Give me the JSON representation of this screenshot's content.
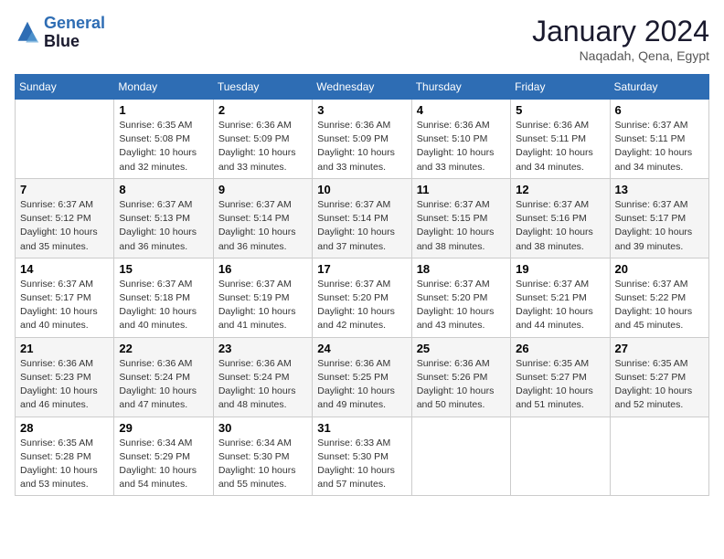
{
  "header": {
    "logo_line1": "General",
    "logo_line2": "Blue",
    "month": "January 2024",
    "location": "Naqadah, Qena, Egypt"
  },
  "days_of_week": [
    "Sunday",
    "Monday",
    "Tuesday",
    "Wednesday",
    "Thursday",
    "Friday",
    "Saturday"
  ],
  "weeks": [
    [
      {
        "day": "",
        "info": ""
      },
      {
        "day": "1",
        "info": "Sunrise: 6:35 AM\nSunset: 5:08 PM\nDaylight: 10 hours\nand 32 minutes."
      },
      {
        "day": "2",
        "info": "Sunrise: 6:36 AM\nSunset: 5:09 PM\nDaylight: 10 hours\nand 33 minutes."
      },
      {
        "day": "3",
        "info": "Sunrise: 6:36 AM\nSunset: 5:09 PM\nDaylight: 10 hours\nand 33 minutes."
      },
      {
        "day": "4",
        "info": "Sunrise: 6:36 AM\nSunset: 5:10 PM\nDaylight: 10 hours\nand 33 minutes."
      },
      {
        "day": "5",
        "info": "Sunrise: 6:36 AM\nSunset: 5:11 PM\nDaylight: 10 hours\nand 34 minutes."
      },
      {
        "day": "6",
        "info": "Sunrise: 6:37 AM\nSunset: 5:11 PM\nDaylight: 10 hours\nand 34 minutes."
      }
    ],
    [
      {
        "day": "7",
        "info": "Sunrise: 6:37 AM\nSunset: 5:12 PM\nDaylight: 10 hours\nand 35 minutes."
      },
      {
        "day": "8",
        "info": "Sunrise: 6:37 AM\nSunset: 5:13 PM\nDaylight: 10 hours\nand 36 minutes."
      },
      {
        "day": "9",
        "info": "Sunrise: 6:37 AM\nSunset: 5:14 PM\nDaylight: 10 hours\nand 36 minutes."
      },
      {
        "day": "10",
        "info": "Sunrise: 6:37 AM\nSunset: 5:14 PM\nDaylight: 10 hours\nand 37 minutes."
      },
      {
        "day": "11",
        "info": "Sunrise: 6:37 AM\nSunset: 5:15 PM\nDaylight: 10 hours\nand 38 minutes."
      },
      {
        "day": "12",
        "info": "Sunrise: 6:37 AM\nSunset: 5:16 PM\nDaylight: 10 hours\nand 38 minutes."
      },
      {
        "day": "13",
        "info": "Sunrise: 6:37 AM\nSunset: 5:17 PM\nDaylight: 10 hours\nand 39 minutes."
      }
    ],
    [
      {
        "day": "14",
        "info": "Sunrise: 6:37 AM\nSunset: 5:17 PM\nDaylight: 10 hours\nand 40 minutes."
      },
      {
        "day": "15",
        "info": "Sunrise: 6:37 AM\nSunset: 5:18 PM\nDaylight: 10 hours\nand 40 minutes."
      },
      {
        "day": "16",
        "info": "Sunrise: 6:37 AM\nSunset: 5:19 PM\nDaylight: 10 hours\nand 41 minutes."
      },
      {
        "day": "17",
        "info": "Sunrise: 6:37 AM\nSunset: 5:20 PM\nDaylight: 10 hours\nand 42 minutes."
      },
      {
        "day": "18",
        "info": "Sunrise: 6:37 AM\nSunset: 5:20 PM\nDaylight: 10 hours\nand 43 minutes."
      },
      {
        "day": "19",
        "info": "Sunrise: 6:37 AM\nSunset: 5:21 PM\nDaylight: 10 hours\nand 44 minutes."
      },
      {
        "day": "20",
        "info": "Sunrise: 6:37 AM\nSunset: 5:22 PM\nDaylight: 10 hours\nand 45 minutes."
      }
    ],
    [
      {
        "day": "21",
        "info": "Sunrise: 6:36 AM\nSunset: 5:23 PM\nDaylight: 10 hours\nand 46 minutes."
      },
      {
        "day": "22",
        "info": "Sunrise: 6:36 AM\nSunset: 5:24 PM\nDaylight: 10 hours\nand 47 minutes."
      },
      {
        "day": "23",
        "info": "Sunrise: 6:36 AM\nSunset: 5:24 PM\nDaylight: 10 hours\nand 48 minutes."
      },
      {
        "day": "24",
        "info": "Sunrise: 6:36 AM\nSunset: 5:25 PM\nDaylight: 10 hours\nand 49 minutes."
      },
      {
        "day": "25",
        "info": "Sunrise: 6:36 AM\nSunset: 5:26 PM\nDaylight: 10 hours\nand 50 minutes."
      },
      {
        "day": "26",
        "info": "Sunrise: 6:35 AM\nSunset: 5:27 PM\nDaylight: 10 hours\nand 51 minutes."
      },
      {
        "day": "27",
        "info": "Sunrise: 6:35 AM\nSunset: 5:27 PM\nDaylight: 10 hours\nand 52 minutes."
      }
    ],
    [
      {
        "day": "28",
        "info": "Sunrise: 6:35 AM\nSunset: 5:28 PM\nDaylight: 10 hours\nand 53 minutes."
      },
      {
        "day": "29",
        "info": "Sunrise: 6:34 AM\nSunset: 5:29 PM\nDaylight: 10 hours\nand 54 minutes."
      },
      {
        "day": "30",
        "info": "Sunrise: 6:34 AM\nSunset: 5:30 PM\nDaylight: 10 hours\nand 55 minutes."
      },
      {
        "day": "31",
        "info": "Sunrise: 6:33 AM\nSunset: 5:30 PM\nDaylight: 10 hours\nand 57 minutes."
      },
      {
        "day": "",
        "info": ""
      },
      {
        "day": "",
        "info": ""
      },
      {
        "day": "",
        "info": ""
      }
    ]
  ]
}
